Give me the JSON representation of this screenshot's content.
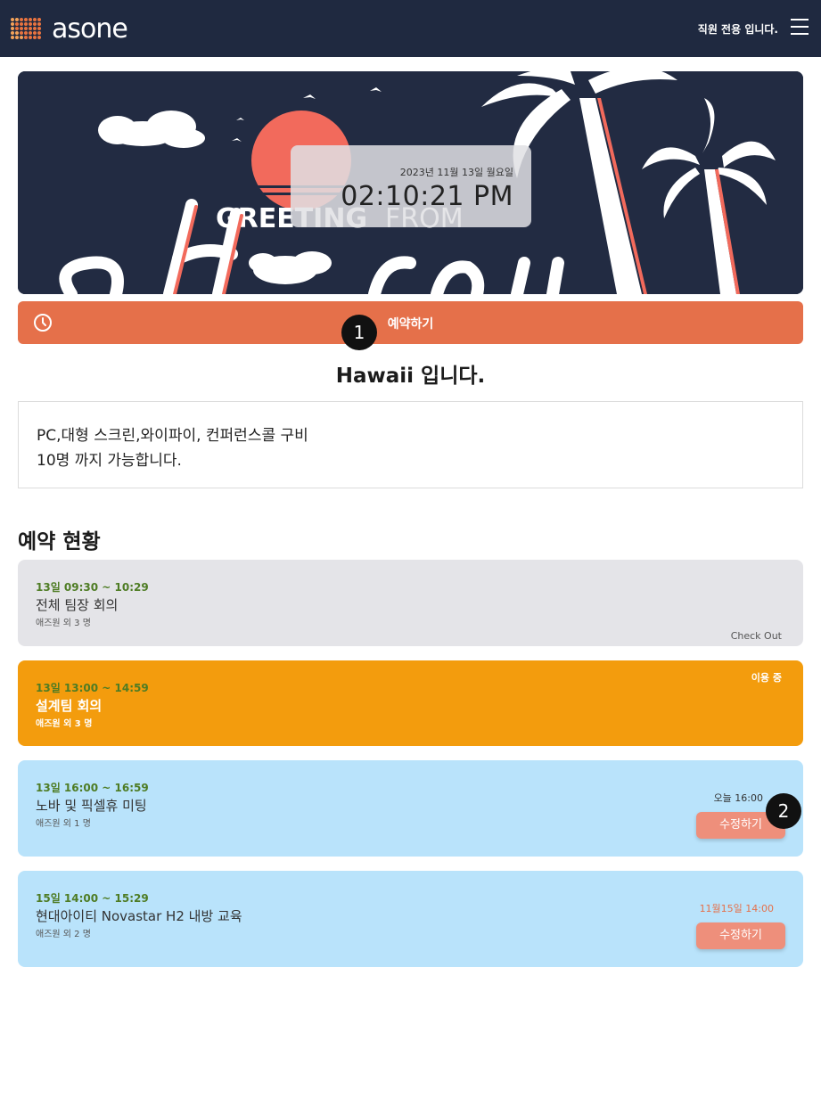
{
  "header": {
    "logo_text": "asone",
    "staff_label": "직원 전용 입니다."
  },
  "banner": {
    "overlay_text_bold": "GREETING",
    "overlay_text_light": "FROM",
    "date": "2023년 11월 13일 월요일",
    "time": "02:10:21 PM"
  },
  "reserve_button": {
    "label": "예약하기"
  },
  "markers": {
    "m1": "1",
    "m2": "2"
  },
  "room": {
    "title": "Hawaii 입니다.",
    "description_lines": [
      "PC,대형 스크린,와이파이, 컨퍼런스콜 구비",
      "10명 까지 가능합니다."
    ]
  },
  "reservations": {
    "section_title": "예약 현황",
    "items": [
      {
        "time": "13일 09:30 ~ 10:29",
        "title": "전체 팀장 회의",
        "people": "애즈원 외 3 명",
        "status": "Check Out"
      },
      {
        "time": "13일 13:00 ~ 14:59",
        "title": "설계팀 회의",
        "people": "애즈원 외 3 명",
        "status": "이용 중"
      },
      {
        "time": "13일 16:00 ~ 16:59",
        "title": "노바 및 픽셀휴 미팅",
        "people": "애즈원 외 1 명",
        "status": "오늘 16:00",
        "button": "수정하기"
      },
      {
        "time": "15일 14:00 ~ 15:29",
        "title": "현대아이티 Novastar H2 내방 교육",
        "people": "애즈원 외 2 명",
        "status": "11월15일 14:00",
        "button": "수정하기"
      }
    ]
  },
  "colors": {
    "header_bg": "#1f2940",
    "accent": "#e5704a",
    "in_use": "#f39c0d",
    "upcoming": "#b9e3fb",
    "past": "#e4e4e8",
    "time_green": "#4e7c24"
  }
}
